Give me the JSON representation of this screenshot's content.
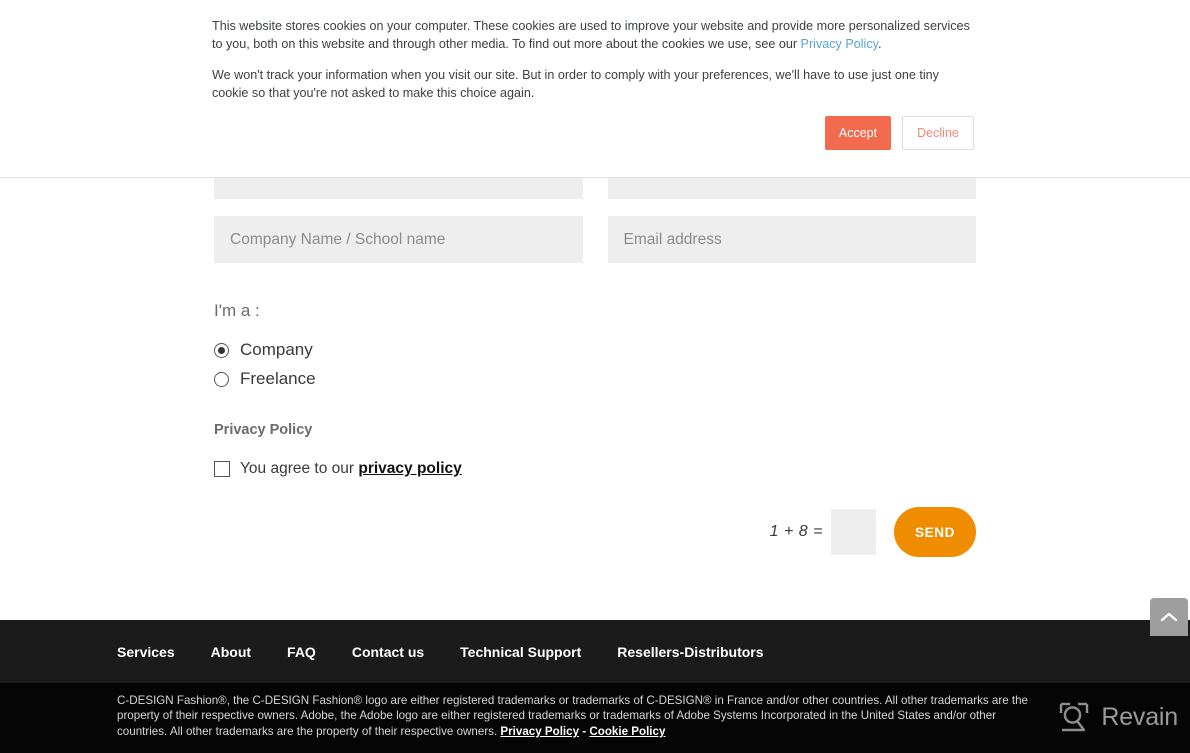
{
  "cookie_banner": {
    "paragraph1_part1": "This website stores cookies on your computer. These cookies are used to improve your website and provide more personalized services to you, both on this website and through other media. To find out more about the cookies we use, see our ",
    "privacy_policy_link": "Privacy Policy",
    "paragraph1_part2": ".",
    "paragraph2": "We won't track your information when you visit our site. But in order to comply with your preferences, we'll have to use just one tiny cookie so that you're not asked to make this choice again.",
    "accept_label": "Accept",
    "decline_label": "Decline",
    "accept_color": "#F26B4E",
    "decline_text_color": "#F08A72",
    "link_color": "#5AA3D6"
  },
  "form": {
    "company_name_placeholder": "Company Name / School name",
    "email_placeholder": "Email address",
    "imma_label": "I'm a :",
    "radios": [
      {
        "label": "Company",
        "checked": true
      },
      {
        "label": "Freelance",
        "checked": false
      }
    ],
    "privacy_heading": "Privacy Policy",
    "agree_text_prefix": "You agree to our ",
    "agree_link": "privacy policy",
    "agree_checked": false,
    "captcha_expression": "1 + 8 =",
    "captcha_value": "",
    "send_label": "SEND",
    "send_color": "#F08C00"
  },
  "scroll_top": {
    "icon": "chevron-up-icon"
  },
  "footer": {
    "nav_items": [
      "Services",
      "About",
      "FAQ",
      "Contact us",
      "Technical Support",
      "Resellers-Distributors"
    ],
    "legal_text": "C-DESIGN Fashion®, the C-DESIGN Fashion® logo are either registered trademarks or trademarks of C-DESIGN® in France and/or other countries. All other trademarks are the property of their respective owners. Adobe, the Adobe logo are either registered trademarks or trademarks of Adobe Systems Incorporated in the United States and/or other countries. All other trademarks are the property of their respective owners. ",
    "legal_privacy_policy": "Privacy Policy",
    "legal_separator": " - ",
    "legal_cookie_policy": "Cookie Policy"
  },
  "watermark": {
    "brand": "Revain",
    "icon": "revain-logo-icon"
  }
}
